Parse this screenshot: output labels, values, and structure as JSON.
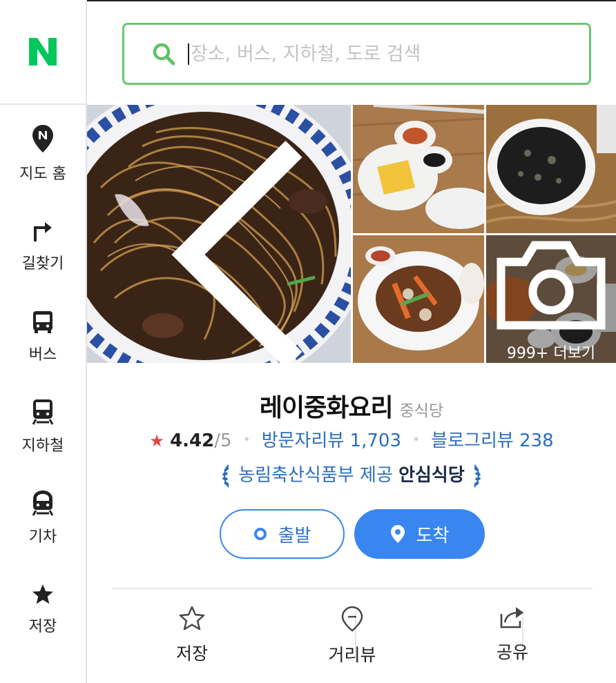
{
  "sidebar": {
    "logo": "N",
    "items": [
      {
        "icon": "map-pin-n-icon",
        "label": "지도 홈"
      },
      {
        "icon": "turn-right-arrow-icon",
        "label": "길찾기"
      },
      {
        "icon": "bus-icon",
        "label": "버스"
      },
      {
        "icon": "subway-icon",
        "label": "지하철"
      },
      {
        "icon": "train-icon",
        "label": "기차"
      },
      {
        "icon": "star-icon",
        "label": "저장"
      }
    ]
  },
  "search": {
    "placeholder": "장소, 버스, 지하철, 도로 검색",
    "value": ""
  },
  "photos": {
    "more_label": "999+ 더보기",
    "icons": {
      "back": "chevron-left-icon",
      "camera": "camera-icon"
    }
  },
  "place": {
    "name": "레이중화요리",
    "category": "중식당",
    "rating": "4.42",
    "rating_max": "/5",
    "visitor_reviews": "방문자리뷰 1,703",
    "blog_reviews": "블로그리뷰 238",
    "badge_provider": "농림축산식품부 제공",
    "badge_label": "안심식당"
  },
  "buttons": {
    "start": "출발",
    "arrive": "도착"
  },
  "actions": [
    {
      "icon": "star-outline-icon",
      "label": "저장"
    },
    {
      "icon": "street-view-pin-icon",
      "label": "거리뷰"
    },
    {
      "icon": "share-icon",
      "label": "공유"
    }
  ],
  "colors": {
    "brand_green": "#03c75a",
    "search_border": "#6cc772",
    "accent_blue": "#3a86f0",
    "link_blue": "#2a6dc2",
    "star_red": "#e8443f"
  }
}
